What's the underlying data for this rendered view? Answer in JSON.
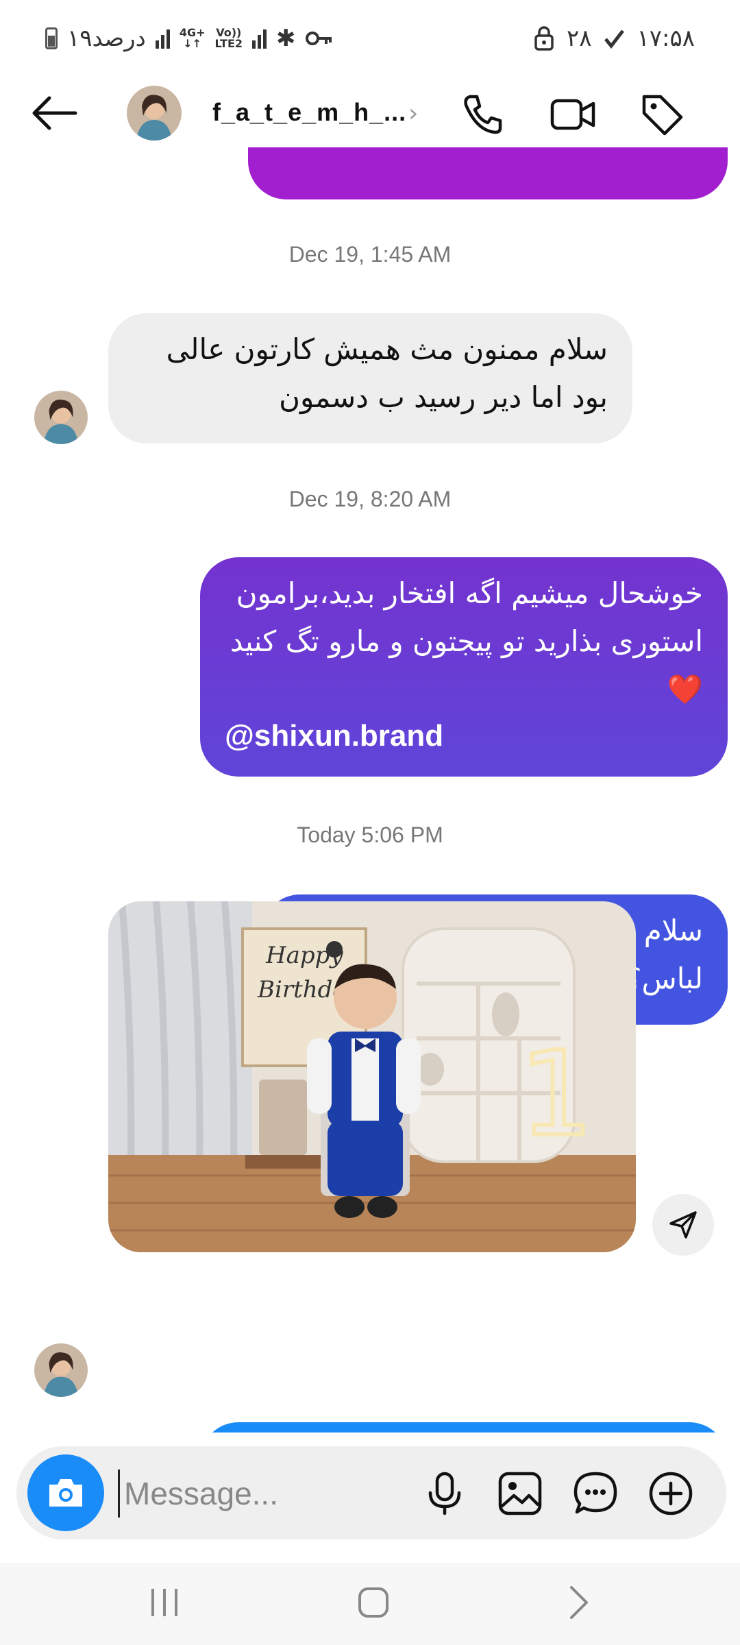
{
  "status_bar": {
    "battery_text": "۱۹درصد",
    "network_1": "4G+",
    "network_2_top": "Vo))",
    "network_2_bottom": "LTE2",
    "day": "۲۸",
    "time": "۱۷:۵۸"
  },
  "header": {
    "username": "f_a_t_e_m_h_...",
    "chevron": "›"
  },
  "messages": [
    {
      "type": "timestamp",
      "text": "Dec 19, 1:45 AM"
    },
    {
      "type": "incoming",
      "text": "سلام ممنون مث همیش کارتون عالی بود اما دیر رسید ب دسمون"
    },
    {
      "type": "timestamp",
      "text": "Dec 19, 8:20 AM"
    },
    {
      "type": "outgoing",
      "text": "خوشحال میشیم اگه افتخار بدید،برامون استوری بذارید تو پیجتون و مارو تگ کنید❤️",
      "mention": "@shixun.brand"
    },
    {
      "type": "timestamp",
      "text": "Today 5:06 PM"
    },
    {
      "type": "outgoing",
      "text": "سلام عزیزم عکس تنخور گرفتید از لباس؟"
    }
  ],
  "photo": {
    "banner_line1": "Happy",
    "banner_line2": "Birthday",
    "neon_number": "1"
  },
  "composer": {
    "placeholder": "Message..."
  },
  "colors": {
    "accent": "#1a8cf7",
    "bubble_purple": "#a21fd0",
    "bubble_violet": "#6a3bd6",
    "bubble_blue": "#4354e0",
    "bubble_light_blue": "#1a8cf7",
    "incoming_bg": "#eeeeee"
  }
}
